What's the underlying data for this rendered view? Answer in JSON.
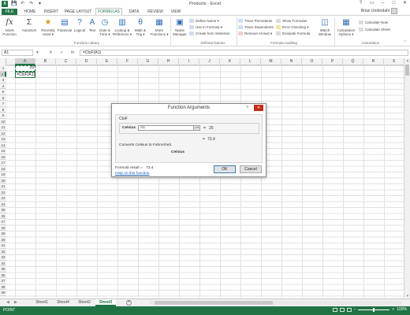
{
  "window": {
    "title": "Products - Excel",
    "user": "Brian Underdahl"
  },
  "qat": {
    "logo": "X",
    "save": "💾",
    "undo": "↶",
    "redo": "↷",
    "dropdown": "▾"
  },
  "ribbon_tabs": [
    "FILE",
    "HOME",
    "INSERT",
    "PAGE LAYOUT",
    "FORMULAS",
    "DATA",
    "REVIEW",
    "VIEW"
  ],
  "ribbon": {
    "function_library": {
      "label": "Function Library",
      "buttons": [
        {
          "name": "Insert Function",
          "line1": "Insert",
          "line2": "Function",
          "icon": "fx"
        },
        {
          "name": "AutoSum",
          "line1": "AutoSum",
          "line2": "",
          "icon": "Σ"
        },
        {
          "name": "Recently Used",
          "line1": "Recently",
          "line2": "Used ▾",
          "icon": "★"
        },
        {
          "name": "Financial",
          "line1": "Financial",
          "line2": "",
          "icon": "▤"
        },
        {
          "name": "Logical",
          "line1": "Logical",
          "line2": "",
          "icon": "?"
        },
        {
          "name": "Text",
          "line1": "Text",
          "line2": "",
          "icon": "A"
        },
        {
          "name": "Date & Time",
          "line1": "Date &",
          "line2": "Time ▾",
          "icon": "◷"
        },
        {
          "name": "Lookup & Reference",
          "line1": "Lookup &",
          "line2": "Reference ▾",
          "icon": "▥"
        },
        {
          "name": "Math & Trig",
          "line1": "Math &",
          "line2": "Trig ▾",
          "icon": "θ"
        },
        {
          "name": "More Functions",
          "line1": "More",
          "line2": "Functions ▾",
          "icon": "▦"
        }
      ]
    },
    "defined_names": {
      "label": "Defined Names",
      "name_manager": {
        "line1": "Name",
        "line2": "Manager"
      },
      "items": [
        "Define Name ▾",
        "Use in Formula ▾",
        "Create from Selection"
      ]
    },
    "formula_auditing": {
      "label": "Formula Auditing",
      "col1": [
        "Trace Precedents",
        "Trace Dependents",
        "Remove Arrows ▾"
      ],
      "col2": [
        "Show Formulas",
        "Error Checking ▾",
        "Evaluate Formula"
      ],
      "watch": {
        "line1": "Watch",
        "line2": "Window"
      }
    },
    "calculation": {
      "label": "Calculation",
      "options": {
        "line1": "Calculation",
        "line2": "Options ▾"
      },
      "items": [
        "Calculate Now",
        "Calculate Sheet"
      ]
    }
  },
  "formula_bar": {
    "name_box": "A1",
    "cancel": "✕",
    "enter": "✓",
    "fx": "fx",
    "formula": "=CtoF(A1)"
  },
  "columns": [
    "A",
    "B",
    "C",
    "D",
    "E",
    "F",
    "G",
    "H",
    "I",
    "J",
    "K",
    "L",
    "M",
    "N",
    "O",
    "P",
    "Q",
    "R",
    "S"
  ],
  "rows": [
    "1",
    "2",
    "3",
    "4",
    "5",
    "6",
    "7",
    "8",
    "9",
    "10",
    "11",
    "12",
    "13",
    "14",
    "15",
    "16",
    "17",
    "18",
    "19",
    "20",
    "21",
    "22",
    "23",
    "24",
    "25",
    "26",
    "27",
    "28",
    "29",
    "30",
    "31",
    "32",
    "33",
    "34",
    "35",
    "36",
    "37",
    "38",
    "39",
    "40"
  ],
  "cells": {
    "a1": "25",
    "a2": "=CtoF(A1)"
  },
  "dialog": {
    "title": "Function Arguments",
    "help": "?",
    "close": "✕",
    "function_name": "CtoF",
    "arg_label": "Celsius",
    "arg_value": "A1",
    "arg_equals": "=",
    "arg_result": "25",
    "result_equals": "=",
    "result_value": "73.4",
    "description": "Converts Celsius to Fahrenheit.",
    "arg_description": "Celsius",
    "formula_result_label": "Formula result =",
    "formula_result_value": "73.4",
    "help_link": "Help on this function",
    "ok": "OK",
    "cancel": "Cancel"
  },
  "sheets": [
    "Sheet1",
    "Sheet4",
    "Sheet2",
    "Sheet3"
  ],
  "active_sheet": "Sheet3",
  "status": {
    "mode": "POINT",
    "zoom": "100%"
  },
  "colors": {
    "accent": "#217346",
    "close": "#c42b1c",
    "link": "#1f5fb0"
  }
}
